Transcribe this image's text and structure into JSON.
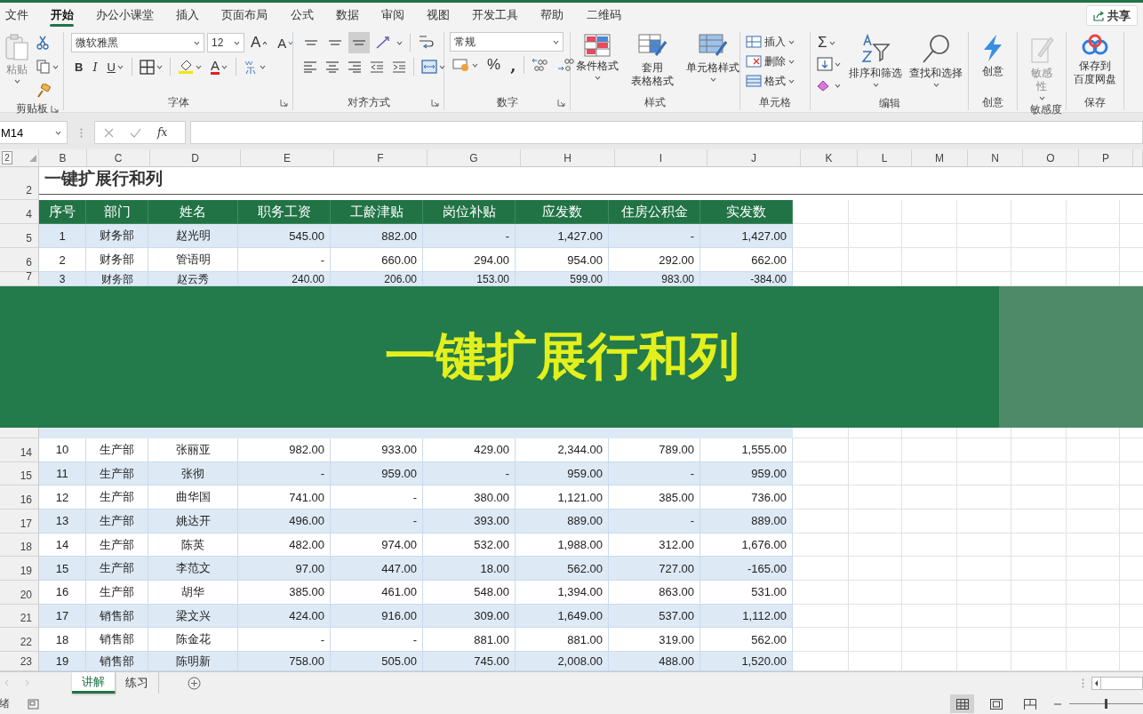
{
  "menu_tabs": [
    {
      "label": "文件",
      "selected": false
    },
    {
      "label": "开始",
      "selected": true
    },
    {
      "label": "办公小课堂",
      "selected": false
    },
    {
      "label": "插入",
      "selected": false
    },
    {
      "label": "页面布局",
      "selected": false
    },
    {
      "label": "公式",
      "selected": false
    },
    {
      "label": "数据",
      "selected": false
    },
    {
      "label": "审阅",
      "selected": false
    },
    {
      "label": "视图",
      "selected": false
    },
    {
      "label": "开发工具",
      "selected": false
    },
    {
      "label": "帮助",
      "selected": false
    },
    {
      "label": "二维码",
      "selected": false
    }
  ],
  "share_button": {
    "label": "共享"
  },
  "ribbon": {
    "groups": [
      {
        "label": "剪贴板",
        "items": [
          {
            "kind": "large",
            "label": "粘贴",
            "disabled": true
          }
        ]
      },
      {
        "label": "字体",
        "items": [
          {
            "kind": "field",
            "value": "微软雅黑"
          },
          {
            "kind": "field",
            "value": "12"
          },
          {
            "kind": "glyph",
            "label": "A"
          },
          {
            "kind": "glyph",
            "label": "A"
          },
          {
            "kind": "glyph",
            "label": "B"
          },
          {
            "kind": "glyph",
            "label": "I"
          },
          {
            "kind": "glyph",
            "label": "U"
          },
          {
            "kind": "glyph",
            "label": "A"
          }
        ]
      },
      {
        "label": "对齐方式",
        "items": [
          {
            "kind": "toggle",
            "selected": false
          },
          {
            "kind": "toggle",
            "selected": false
          },
          {
            "kind": "toggle",
            "selected": true
          }
        ]
      },
      {
        "label": "数字",
        "items": [
          {
            "kind": "field",
            "value": "常规"
          },
          {
            "kind": "glyph",
            "label": "%"
          },
          {
            "kind": "glyph",
            "label": ","
          }
        ]
      },
      {
        "label": "样式",
        "items": [
          {
            "kind": "large",
            "label": "条件格式"
          },
          {
            "kind": "large",
            "label": "套用表格格式"
          },
          {
            "kind": "large",
            "label": "单元格样式"
          }
        ]
      },
      {
        "label": "单元格",
        "items": [
          {
            "kind": "small",
            "label": "插入"
          },
          {
            "kind": "small",
            "label": "删除"
          },
          {
            "kind": "small",
            "label": "格式"
          }
        ]
      },
      {
        "label": "编辑",
        "items": [
          {
            "kind": "glyph",
            "label": "Σ"
          },
          {
            "kind": "large",
            "label": "排序和筛选"
          },
          {
            "kind": "large",
            "label": "查找和选择"
          }
        ]
      },
      {
        "label": "创意",
        "items": [
          {
            "kind": "large",
            "label": "创意"
          }
        ]
      },
      {
        "label": "敏感度",
        "items": [
          {
            "kind": "large",
            "label": "敏感性",
            "disabled": true
          }
        ]
      },
      {
        "label": "保存",
        "items": [
          {
            "kind": "large",
            "label": "保存到百度网盘"
          }
        ]
      }
    ]
  },
  "formula_bar": {
    "name_box": "M14",
    "function_label": "fx"
  },
  "sheet": {
    "outline_level": "2",
    "columns": [
      "B",
      "C",
      "D",
      "E",
      "F",
      "G",
      "H",
      "I",
      "J",
      "K",
      "L",
      "M",
      "N",
      "O",
      "P"
    ],
    "title_row": {
      "row": "2",
      "title": "一键扩展行和列"
    },
    "header_row": {
      "row": "4",
      "cells": [
        "序号",
        "部门",
        "姓名",
        "职务工资",
        "工龄津贴",
        "岗位补贴",
        "应发数",
        "住房公积金",
        "实发数"
      ]
    },
    "rows_above": [
      {
        "row": "5",
        "shaded": true,
        "cells": [
          "1",
          "财务部",
          "赵光明",
          "545.00",
          "882.00",
          "-",
          "1,427.00",
          "-",
          "1,427.00"
        ]
      },
      {
        "row": "6",
        "shaded": false,
        "cells": [
          "2",
          "财务部",
          "管语明",
          "-",
          "660.00",
          "294.00",
          "954.00",
          "292.00",
          "662.00"
        ]
      },
      {
        "row": "7",
        "shaded": true,
        "cells": [
          "3",
          "财务部",
          "赵云秀",
          "240.00",
          "206.00",
          "153.00",
          "599.00",
          "983.00",
          "-384.00"
        ]
      }
    ],
    "rows_below": [
      {
        "row": "14",
        "shaded": false,
        "cells": [
          "10",
          "生产部",
          "张丽亚",
          "982.00",
          "933.00",
          "429.00",
          "2,344.00",
          "789.00",
          "1,555.00"
        ]
      },
      {
        "row": "15",
        "shaded": true,
        "cells": [
          "11",
          "生产部",
          "张彻",
          "-",
          "959.00",
          "-",
          "959.00",
          "-",
          "959.00"
        ]
      },
      {
        "row": "16",
        "shaded": false,
        "cells": [
          "12",
          "生产部",
          "曲华国",
          "741.00",
          "-",
          "380.00",
          "1,121.00",
          "385.00",
          "736.00"
        ]
      },
      {
        "row": "17",
        "shaded": true,
        "cells": [
          "13",
          "生产部",
          "姚达开",
          "496.00",
          "-",
          "393.00",
          "889.00",
          "-",
          "889.00"
        ]
      },
      {
        "row": "18",
        "shaded": false,
        "cells": [
          "14",
          "生产部",
          "陈英",
          "482.00",
          "974.00",
          "532.00",
          "1,988.00",
          "312.00",
          "1,676.00"
        ]
      },
      {
        "row": "19",
        "shaded": true,
        "cells": [
          "15",
          "生产部",
          "李范文",
          "97.00",
          "447.00",
          "18.00",
          "562.00",
          "727.00",
          "-165.00"
        ]
      },
      {
        "row": "20",
        "shaded": false,
        "cells": [
          "16",
          "生产部",
          "胡华",
          "385.00",
          "461.00",
          "548.00",
          "1,394.00",
          "863.00",
          "531.00"
        ]
      },
      {
        "row": "21",
        "shaded": true,
        "cells": [
          "17",
          "销售部",
          "梁文兴",
          "424.00",
          "916.00",
          "309.00",
          "1,649.00",
          "537.00",
          "1,112.00"
        ]
      },
      {
        "row": "22",
        "shaded": false,
        "cells": [
          "18",
          "销售部",
          "陈金花",
          "-",
          "-",
          "881.00",
          "881.00",
          "319.00",
          "562.00"
        ]
      },
      {
        "row": "23",
        "shaded": true,
        "cells": [
          "19",
          "销售部",
          "陈明新",
          "758.00",
          "505.00",
          "745.00",
          "2,008.00",
          "488.00",
          "1,520.00"
        ]
      }
    ]
  },
  "banner": {
    "title": "一键扩展行和列"
  },
  "sheet_tabs": [
    {
      "label": "讲解",
      "selected": true
    },
    {
      "label": "练习",
      "selected": false
    }
  ],
  "status_bar": {
    "status": "绪",
    "view_buttons": [
      {
        "selected": true
      },
      {
        "selected": false
      },
      {
        "selected": false
      }
    ],
    "zoom_slider": {
      "level": 0.5
    }
  }
}
